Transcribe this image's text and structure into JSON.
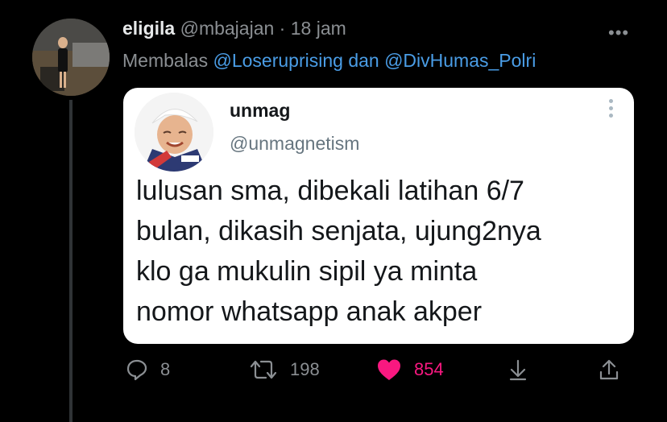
{
  "tweet": {
    "display_name": "eligila",
    "handle": "@mbajajan",
    "separator": "·",
    "time": "18 jam",
    "more_label": "•••",
    "reply_prefix": "Membalas",
    "reply_mentions": "@Loseruprising dan @DivHumas_Polri"
  },
  "quoted": {
    "display_name": "unmag",
    "handle": "@unmagnetism",
    "text_lines": [
      "lulusan sma, dibekali latihan 6/7",
      "bulan, dikasih senjata, ujung2nya",
      "klo ga mukulin sipil ya minta",
      "nomor whatsapp anak akper"
    ]
  },
  "actions": {
    "reply_count": "8",
    "retweet_count": "198",
    "like_count": "854",
    "reply_icon": "speech-bubble-icon",
    "retweet_icon": "retweet-icon",
    "like_icon": "heart-icon",
    "download_icon": "download-arrow-icon",
    "share_icon": "share-icon"
  },
  "colors": {
    "background": "#000000",
    "link": "#4a9de6",
    "like": "#f91880",
    "muted": "#8b8f93"
  }
}
